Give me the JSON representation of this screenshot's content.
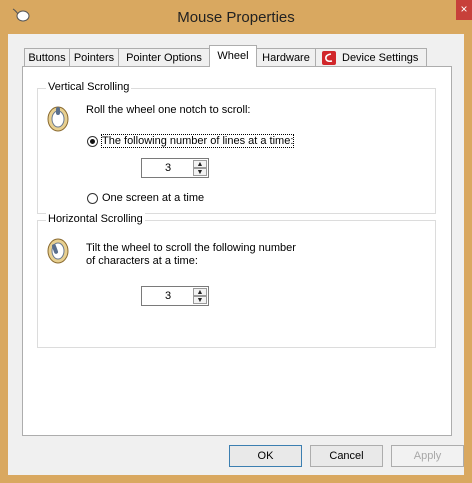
{
  "window": {
    "title": "Mouse Properties",
    "close_glyph": "×",
    "icon": "mouse-icon",
    "frame_color": "#d9a860"
  },
  "tabs": [
    {
      "label": "Buttons"
    },
    {
      "label": "Pointers"
    },
    {
      "label": "Pointer Options"
    },
    {
      "label": "Wheel",
      "active": true
    },
    {
      "label": "Hardware"
    },
    {
      "label": "Device Settings",
      "icon": "synaptics-icon"
    }
  ],
  "vertical": {
    "title": "Vertical Scrolling",
    "icon": "wheel-icon",
    "instruction": "Roll the wheel one notch to scroll:",
    "option_lines": "The following number of lines at a time:",
    "lines_value": "3",
    "option_screen": "One screen at a time"
  },
  "horizontal": {
    "title": "Horizontal Scrolling",
    "icon": "wheel-icon",
    "instruction_line1": "Tilt the wheel to scroll the following number",
    "instruction_line2": "of characters at a time:",
    "chars_value": "3"
  },
  "buttons": {
    "ok": "OK",
    "cancel": "Cancel",
    "apply": "Apply"
  }
}
